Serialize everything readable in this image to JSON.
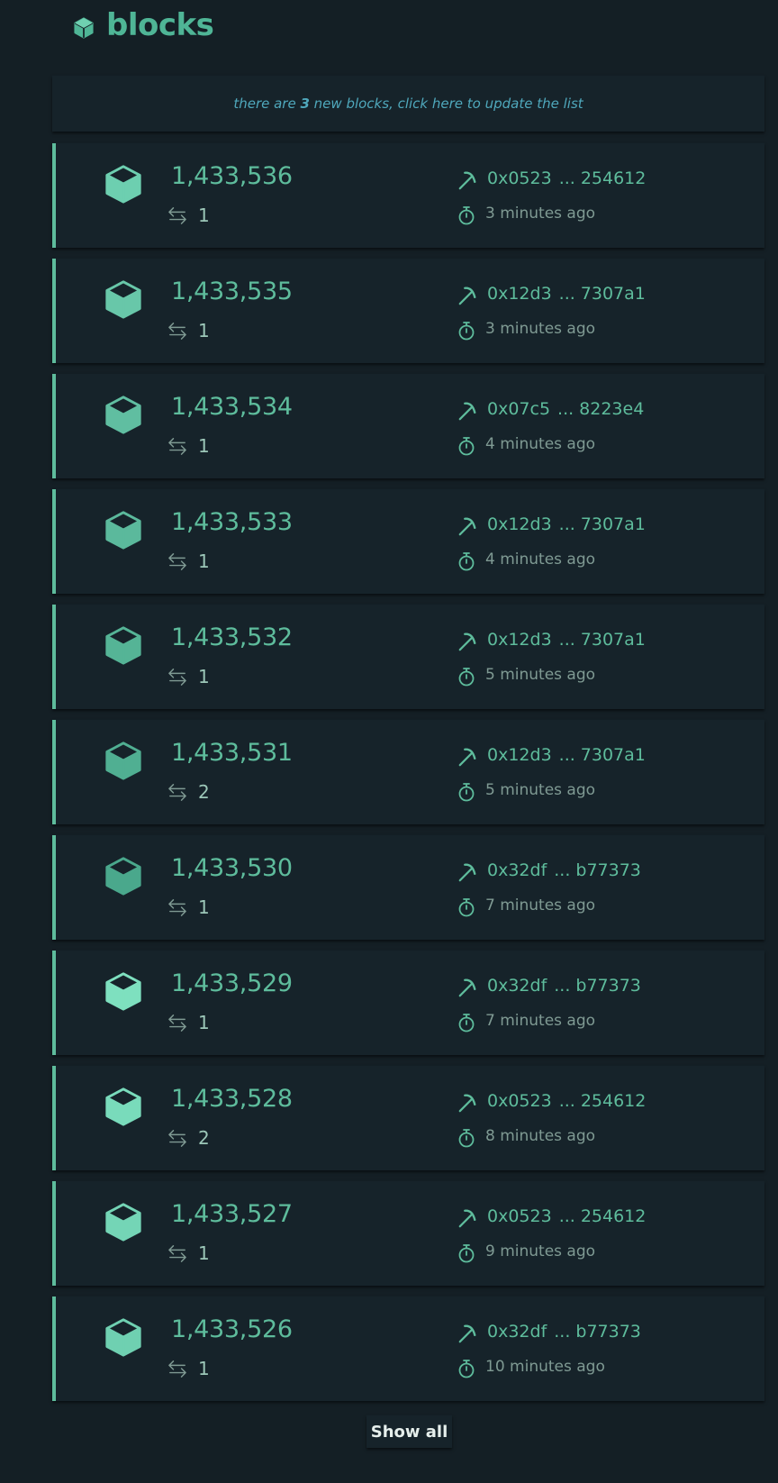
{
  "header": {
    "title": "blocks",
    "icon": "cube-icon"
  },
  "notice": {
    "prefix": "there are ",
    "count": "3",
    "suffix": " new blocks, click here to update the list"
  },
  "colors": {
    "accent": "#5ebc9c",
    "background": "#141f25",
    "card": "#16232a"
  },
  "blocks": [
    {
      "number": "1,433,536",
      "tx_count": "1",
      "miner_prefix": "0x0523",
      "miner_ellipsis": "...",
      "miner_suffix": "254612",
      "time": "3 minutes ago",
      "cube_color": "#6dcfb0"
    },
    {
      "number": "1,433,535",
      "tx_count": "1",
      "miner_prefix": "0x12d3",
      "miner_ellipsis": "...",
      "miner_suffix": "7307a1",
      "time": "3 minutes ago",
      "cube_color": "#68c7a9"
    },
    {
      "number": "1,433,534",
      "tx_count": "1",
      "miner_prefix": "0x07c5",
      "miner_ellipsis": "...",
      "miner_suffix": "8223e4",
      "time": "4 minutes ago",
      "cube_color": "#60bea1"
    },
    {
      "number": "1,433,533",
      "tx_count": "1",
      "miner_prefix": "0x12d3",
      "miner_ellipsis": "...",
      "miner_suffix": "7307a1",
      "time": "4 minutes ago",
      "cube_color": "#5bb99c"
    },
    {
      "number": "1,433,532",
      "tx_count": "1",
      "miner_prefix": "0x12d3",
      "miner_ellipsis": "...",
      "miner_suffix": "7307a1",
      "time": "5 minutes ago",
      "cube_color": "#55b496"
    },
    {
      "number": "1,433,531",
      "tx_count": "2",
      "miner_prefix": "0x12d3",
      "miner_ellipsis": "...",
      "miner_suffix": "7307a1",
      "time": "5 minutes ago",
      "cube_color": "#50af92"
    },
    {
      "number": "1,433,530",
      "tx_count": "1",
      "miner_prefix": "0x32df",
      "miner_ellipsis": "...",
      "miner_suffix": "b77373",
      "time": "7 minutes ago",
      "cube_color": "#4aa88c"
    },
    {
      "number": "1,433,529",
      "tx_count": "1",
      "miner_prefix": "0x32df",
      "miner_ellipsis": "...",
      "miner_suffix": "b77373",
      "time": "7 minutes ago",
      "cube_color": "#7ee0bf"
    },
    {
      "number": "1,433,528",
      "tx_count": "2",
      "miner_prefix": "0x0523",
      "miner_ellipsis": "...",
      "miner_suffix": "254612",
      "time": "8 minutes ago",
      "cube_color": "#79dbbb"
    },
    {
      "number": "1,433,527",
      "tx_count": "1",
      "miner_prefix": "0x0523",
      "miner_ellipsis": "...",
      "miner_suffix": "254612",
      "time": "9 minutes ago",
      "cube_color": "#74d5b6"
    },
    {
      "number": "1,433,526",
      "tx_count": "1",
      "miner_prefix": "0x32df",
      "miner_ellipsis": "...",
      "miner_suffix": "b77373",
      "time": "10 minutes ago",
      "cube_color": "#6fd0b1"
    }
  ],
  "footer": {
    "show_all_label": "Show all"
  }
}
